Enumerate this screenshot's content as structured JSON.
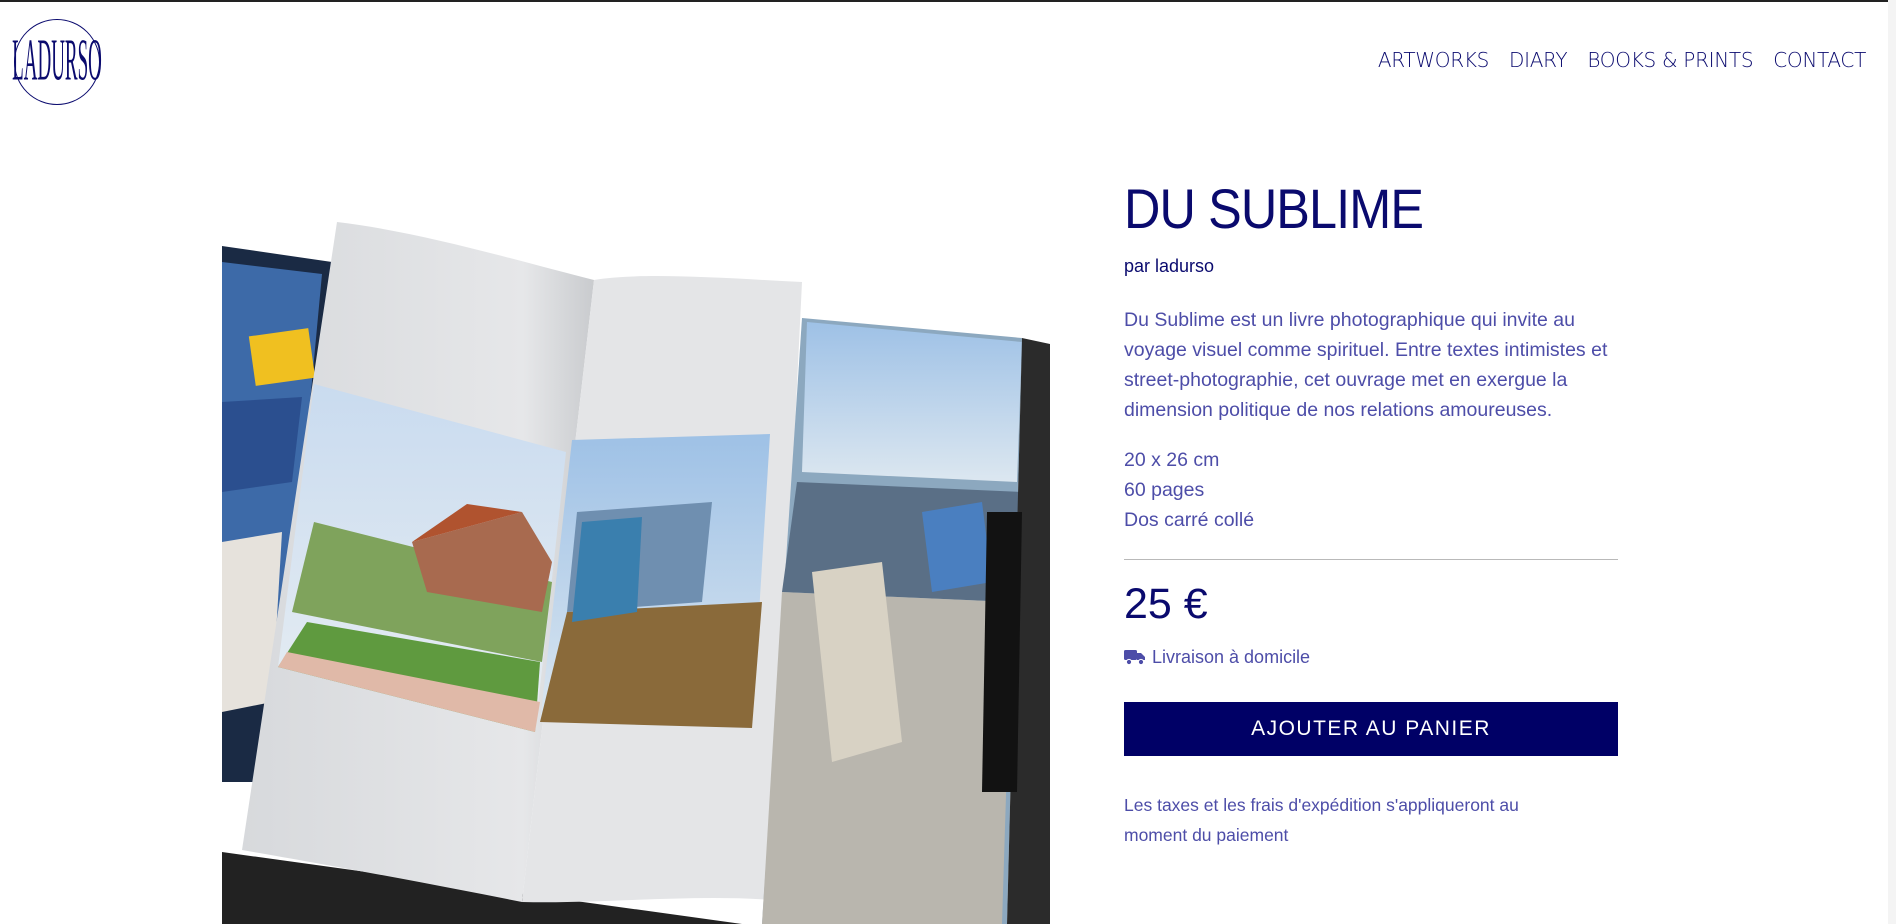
{
  "header": {
    "logo_text": "LADURSO",
    "nav": [
      {
        "label": "ARTWORKS"
      },
      {
        "label": "DIARY"
      },
      {
        "label": "BOOKS & PRINTS"
      },
      {
        "label": "CONTACT"
      }
    ]
  },
  "product": {
    "title": "DU SUBLIME",
    "author": "par ladurso",
    "description": "Du Sublime est un livre photographique qui invite au voyage visuel comme spirituel. Entre textes intimistes et street-photographie, cet ouvrage met en exergue la dimension politique de nos relations amoureuses.",
    "specs": [
      "20 x 26 cm",
      "60 pages",
      "Dos carré collé"
    ],
    "price": "25 €",
    "delivery": "Livraison à domicile",
    "delivery_icon": "truck-icon",
    "cart_button": "AJOUTER AU PANIER",
    "tax_note": "Les taxes et les frais d'expédition s'appliqueront au moment du paiement",
    "image_subject": "book-mockup-image"
  },
  "colors": {
    "primary": "#0a0a6e",
    "button": "#000066",
    "text_soft": "#4d4da8"
  }
}
